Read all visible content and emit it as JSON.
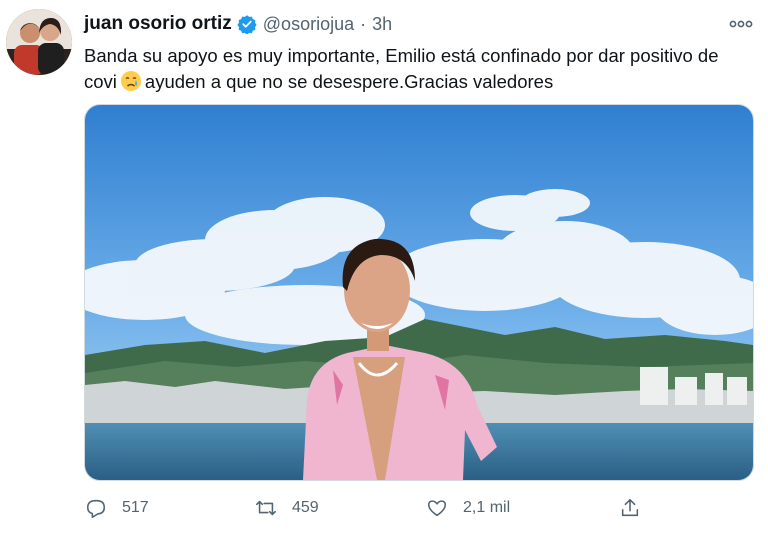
{
  "tweet": {
    "author_name": "juan osorio ortiz",
    "handle": "@osoriojua",
    "separator": "·",
    "time": "3h",
    "text_before_emoji": "Banda su apoyo es muy importante, Emilio está confinado por dar positivo de covi",
    "emoji": "crying-face",
    "text_after_emoji": "ayuden a que no se desespere.Gracias valedores",
    "media_description": "photo",
    "verified": true
  },
  "actions": {
    "replies": "517",
    "retweets": "459",
    "likes": "2,1 mil"
  },
  "colors": {
    "accent": "#1d9bf0",
    "text_primary": "#0f1419",
    "text_secondary": "#536471"
  }
}
